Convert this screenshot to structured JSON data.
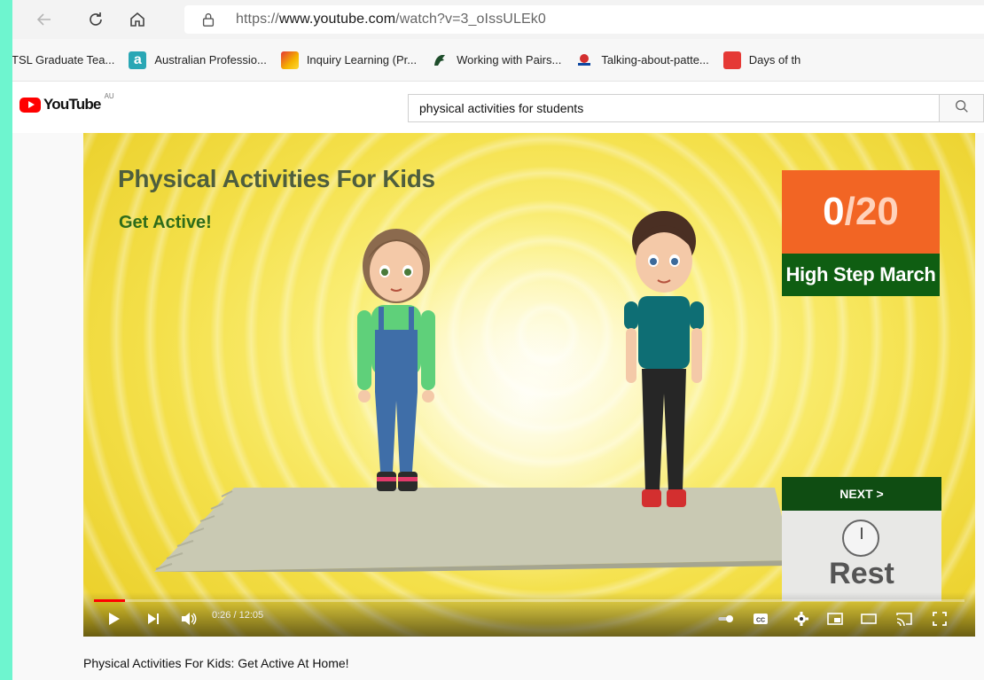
{
  "browser": {
    "url_prefix": "https://",
    "url_host": "www.youtube.com",
    "url_path": "/watch?v=3_oIssULEk0",
    "icons": [
      "back-arrow-icon",
      "reload-icon",
      "home-icon",
      "lock-icon"
    ]
  },
  "bookmarks": [
    {
      "label": "TSL Graduate Tea...",
      "icon": "none"
    },
    {
      "label": "Australian Professio...",
      "icon": "a",
      "color": "#2aa7b5"
    },
    {
      "label": "Inquiry Learning (Pr...",
      "icon": "",
      "color": "#f5b400"
    },
    {
      "label": "Working with Pairs...",
      "icon": "",
      "color": "#1e4d2b"
    },
    {
      "label": "Talking-about-patte...",
      "icon": "",
      "color": "#d32f2f"
    },
    {
      "label": "Days of th",
      "icon": "",
      "color": "#e53935"
    }
  ],
  "youtube": {
    "logo_text": "YouTube",
    "region": "AU",
    "search_value": "physical activities for students"
  },
  "video": {
    "title_overlay": "Physical Activities For Kids",
    "subtitle_overlay": "Get Active!",
    "count_current": "0",
    "count_total": "/20",
    "exercise": "High Step March",
    "next_label": "NEXT >",
    "next_exercise": "Rest",
    "time_display": "0:26 / 12:05",
    "progress_fraction": 0.036,
    "title_below": "Physical Activities For Kids: Get Active At Home!"
  },
  "colors": {
    "page_border": "#6ef5cf",
    "counter_orange": "#f26524",
    "counter_green": "#0f5e12",
    "youtube_red": "#ff0000"
  }
}
